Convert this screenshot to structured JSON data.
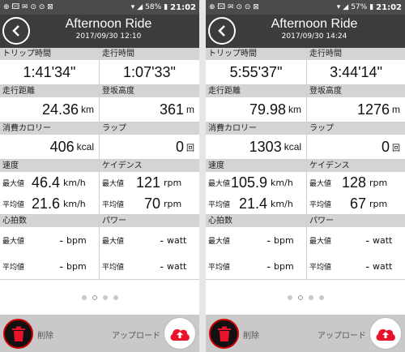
{
  "screens": [
    {
      "status": {
        "battery": "58%",
        "time": "21:02",
        "icons": "⊕ 🖾 ✉ ⊙ ⊙ ⊠"
      },
      "header": {
        "title": "Afternoon Ride",
        "datetime": "2017/09/30 12:10"
      },
      "labels": {
        "trip_time": "トリップ時間",
        "moving_time": "走行時間",
        "distance": "走行距離",
        "elevation": "登坂高度",
        "calories": "消費カロリー",
        "laps": "ラップ",
        "speed": "速度",
        "cadence": "ケイデンス",
        "heart_rate": "心拍数",
        "power": "パワー",
        "max": "最大値",
        "avg": "平均値"
      },
      "values": {
        "trip_time": "1:41'34\"",
        "moving_time": "1:07'33\"",
        "distance": "24.36",
        "distance_unit": "km",
        "elevation": "361",
        "elevation_unit": "m",
        "calories": "406",
        "calories_unit": "kcal",
        "laps": "0",
        "laps_unit": "回",
        "speed_max": "46.4",
        "speed_avg": "21.6",
        "speed_unit": "km/h",
        "cad_max": "121",
        "cad_avg": "70",
        "cad_unit": "rpm",
        "hr_max": "-",
        "hr_avg": "-",
        "hr_unit": "bpm",
        "pw_max": "-",
        "pw_avg": "-",
        "pw_unit": "watt"
      },
      "footer": {
        "delete": "削除",
        "upload": "アップロード"
      }
    },
    {
      "status": {
        "battery": "57%",
        "time": "21:02",
        "icons": "⊕ 🖾 ✉ ⊙ ⊙ ⊠"
      },
      "header": {
        "title": "Afternoon Ride",
        "datetime": "2017/09/30 14:24"
      },
      "labels": {
        "trip_time": "トリップ時間",
        "moving_time": "走行時間",
        "distance": "走行距離",
        "elevation": "登坂高度",
        "calories": "消費カロリー",
        "laps": "ラップ",
        "speed": "速度",
        "cadence": "ケイデンス",
        "heart_rate": "心拍数",
        "power": "パワー",
        "max": "最大値",
        "avg": "平均値"
      },
      "values": {
        "trip_time": "5:55'37\"",
        "moving_time": "3:44'14\"",
        "distance": "79.98",
        "distance_unit": "km",
        "elevation": "1276",
        "elevation_unit": "m",
        "calories": "1303",
        "calories_unit": "kcal",
        "laps": "0",
        "laps_unit": "回",
        "speed_max": "105.9",
        "speed_avg": "21.4",
        "speed_unit": "km/h",
        "cad_max": "128",
        "cad_avg": "67",
        "cad_unit": "rpm",
        "hr_max": "-",
        "hr_avg": "-",
        "hr_unit": "bpm",
        "pw_max": "-",
        "pw_avg": "-",
        "pw_unit": "watt"
      },
      "footer": {
        "delete": "削除",
        "upload": "アップロード"
      }
    }
  ],
  "pager": {
    "count": 4,
    "active": 1
  },
  "colors": {
    "header": "#3c3c3c",
    "statusbar": "#4b4b4b",
    "label_bg": "#d4d4d4",
    "footer": "#c9c9c9",
    "accent": "#e8132b"
  },
  "icons": {
    "back": "chevron-left-icon",
    "delete": "trash-icon",
    "upload": "cloud-upload-icon"
  }
}
